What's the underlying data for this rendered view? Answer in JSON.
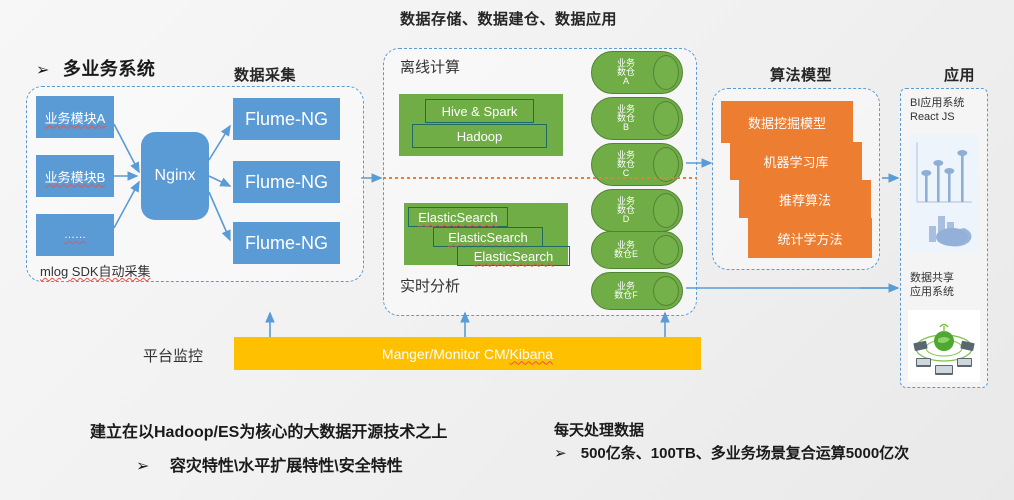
{
  "sections": {
    "multi_business": "多业务系统",
    "data_collect": "数据采集",
    "storage_title": "数据存储、数据建仓、数据应用",
    "offline_compute": "离线计算",
    "realtime_analysis": "实时分析",
    "algorithm_model": "算法模型",
    "application": "应用"
  },
  "left": {
    "modules": [
      "业务模块A",
      "业务模块B",
      "……"
    ],
    "nginx": "Nginx",
    "flume": [
      "Flume-NG",
      "Flume-NG",
      "Flume-NG"
    ],
    "footer": "mlog SDK自动采集"
  },
  "middle": {
    "offline_boxes": [
      "Hive & Spark",
      "Hadoop"
    ],
    "realtime_boxes": [
      "ElasticSearch",
      "ElasticSearch",
      "ElasticSearch"
    ],
    "warehouses": [
      {
        "l1": "业务",
        "l2": "数仓",
        "l3": "A"
      },
      {
        "l1": "业务",
        "l2": "数仓",
        "l3": "B"
      },
      {
        "l1": "业务",
        "l2": "数仓",
        "l3": "C"
      },
      {
        "l1": "业务",
        "l2": "数仓",
        "l3": "D"
      },
      {
        "l1": "业务",
        "l2": "数仓E",
        "l3": ""
      },
      {
        "l1": "业务",
        "l2": "数仓F",
        "l3": ""
      }
    ]
  },
  "algorithm": {
    "items": [
      "数据挖掘模型",
      "机器学习库",
      "推荐算法",
      "统计学方法"
    ]
  },
  "apps": {
    "bi_caption": "BI应用系统\nReact JS",
    "share_caption": "数据共享\n应用系统"
  },
  "monitor": {
    "label": "平台监控",
    "bar_text_1": "Manger/Monitor  CM/",
    "bar_text_2": "Kibana"
  },
  "footer": {
    "left_line1": "建立在以Hadoop/ES为核心的大数据开源技术之上",
    "left_bullet": "➢",
    "left_line2": "容灾特性\\水平扩展特性\\安全特性",
    "right_line1": "每天处理数据",
    "right_bullet": "➢",
    "right_line2": "500亿条、100TB、多业务场景复合运算5000亿次"
  },
  "colors": {
    "blue": "#5b9bd5",
    "green": "#70ad47",
    "orange": "#ed7d31",
    "yellow": "#ffc000",
    "dashed_border": "#5b9bd5",
    "divider_dotted": "#ed7d31"
  }
}
